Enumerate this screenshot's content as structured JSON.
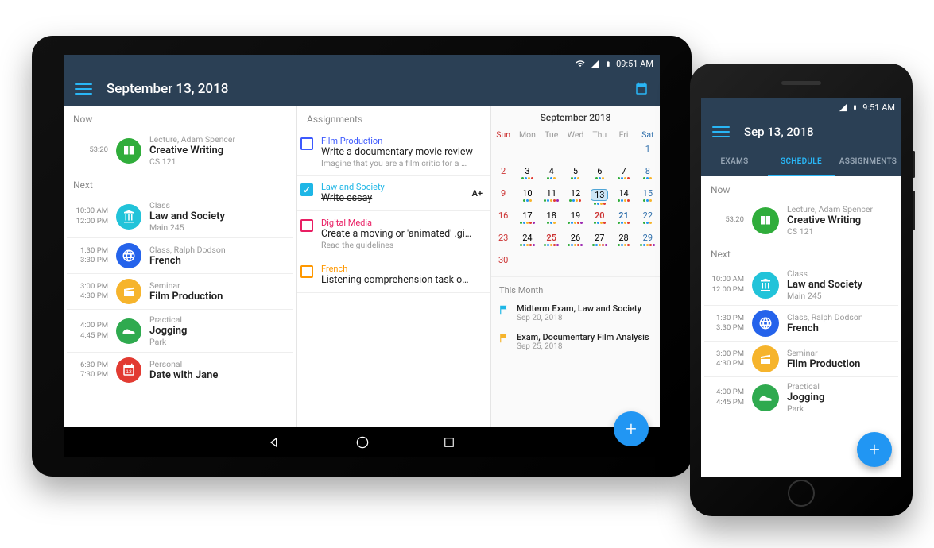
{
  "tablet": {
    "status_time": "09:51 AM",
    "title": "September 13, 2018",
    "now_label": "Now",
    "next_label": "Next",
    "now": {
      "countdown": "53:20",
      "meta": "Lecture, Adam Spencer",
      "title": "Creative Writing",
      "sub": "CS 121",
      "color": "#30ad3b"
    },
    "next": [
      {
        "t1": "10:00 AM",
        "t2": "12:00 PM",
        "meta": "Class",
        "title": "Law and Society",
        "sub": "Main 245",
        "color": "#22c3d9",
        "icon": "pillar"
      },
      {
        "t1": "1:30 PM",
        "t2": "3:30 PM",
        "meta": "Class, Ralph Dodson",
        "title": "French",
        "sub": "",
        "color": "#2563eb",
        "icon": "globe"
      },
      {
        "t1": "3:00 PM",
        "t2": "4:30 PM",
        "meta": "Seminar",
        "title": "Film Production",
        "sub": "",
        "color": "#f6b42c",
        "icon": "clapper"
      },
      {
        "t1": "4:00 PM",
        "t2": "4:45 PM",
        "meta": "Practical",
        "title": "Jogging",
        "sub": "Park",
        "color": "#2faa4f",
        "icon": "shoe"
      },
      {
        "t1": "6:30 PM",
        "t2": "7:30 PM",
        "meta": "Personal",
        "title": "Date with Jane",
        "sub": "",
        "color": "#e23b32",
        "icon": "date"
      }
    ],
    "assignments_label": "Assignments",
    "assignments": [
      {
        "course": "Film Production",
        "course_color": "#3d5afe",
        "title": "Write a documentary movie review",
        "desc": "Imagine that you are a film critic for a …",
        "chk_color": "#3d5afe",
        "done": false,
        "grade": ""
      },
      {
        "course": "Law and Society",
        "course_color": "#1eb6e6",
        "title": "Write essay",
        "desc": "",
        "chk_color": "#1eb6e6",
        "done": true,
        "grade": "A+"
      },
      {
        "course": "Digital Media",
        "course_color": "#e91e63",
        "title": "Create a moving or 'animated' .gi…",
        "desc": "Read the guidelines",
        "chk_color": "#e91e63",
        "done": false,
        "grade": ""
      },
      {
        "course": "French",
        "course_color": "#ff9800",
        "title": "Listening comprehension task o…",
        "desc": "",
        "chk_color": "#ff9800",
        "done": false,
        "grade": ""
      }
    ],
    "calendar": {
      "month": "September 2018",
      "weekdays": [
        "Sun",
        "Mon",
        "Tue",
        "Wed",
        "Thu",
        "Fri",
        "Sat"
      ],
      "first_wd": 6,
      "days": 30,
      "today": 13,
      "dot_days": [
        3,
        4,
        5,
        6,
        7,
        8,
        10,
        11,
        12,
        13,
        14,
        15,
        17,
        18,
        19,
        20,
        21,
        22,
        24,
        25,
        26,
        27,
        28,
        29
      ],
      "red_days": [
        20,
        25
      ],
      "blue_days": [
        21
      ]
    },
    "this_month_label": "This Month",
    "this_month": [
      {
        "title": "Midterm Exam, Law and Society",
        "date": "Sep 20, 2018",
        "color": "#1eb6e6"
      },
      {
        "title": "Exam, Documentary Film Analysis",
        "date": "Sep 25, 2018",
        "color": "#f6b42c"
      }
    ]
  },
  "phone": {
    "status_time": "9:51 AM",
    "title": "Sep 13, 2018",
    "tabs": [
      "EXAMS",
      "SCHEDULE",
      "ASSIGNMENTS"
    ],
    "active_tab": 1,
    "now_label": "Now",
    "next_label": "Next",
    "now": {
      "countdown": "53:20",
      "meta": "Lecture, Adam Spencer",
      "title": "Creative Writing",
      "sub": "CS 121",
      "color": "#30ad3b"
    },
    "next": [
      {
        "t1": "10:00 AM",
        "t2": "12:00 PM",
        "meta": "Class",
        "title": "Law and Society",
        "sub": "Main 245",
        "color": "#22c3d9",
        "icon": "pillar"
      },
      {
        "t1": "1:30 PM",
        "t2": "3:30 PM",
        "meta": "Class, Ralph Dodson",
        "title": "French",
        "sub": "",
        "color": "#2563eb",
        "icon": "globe"
      },
      {
        "t1": "3:00 PM",
        "t2": "4:30 PM",
        "meta": "Seminar",
        "title": "Film Production",
        "sub": "",
        "color": "#f6b42c",
        "icon": "clapper"
      },
      {
        "t1": "4:00 PM",
        "t2": "4:45 PM",
        "meta": "Practical",
        "title": "Jogging",
        "sub": "Park",
        "color": "#2faa4f",
        "icon": "shoe"
      }
    ]
  }
}
